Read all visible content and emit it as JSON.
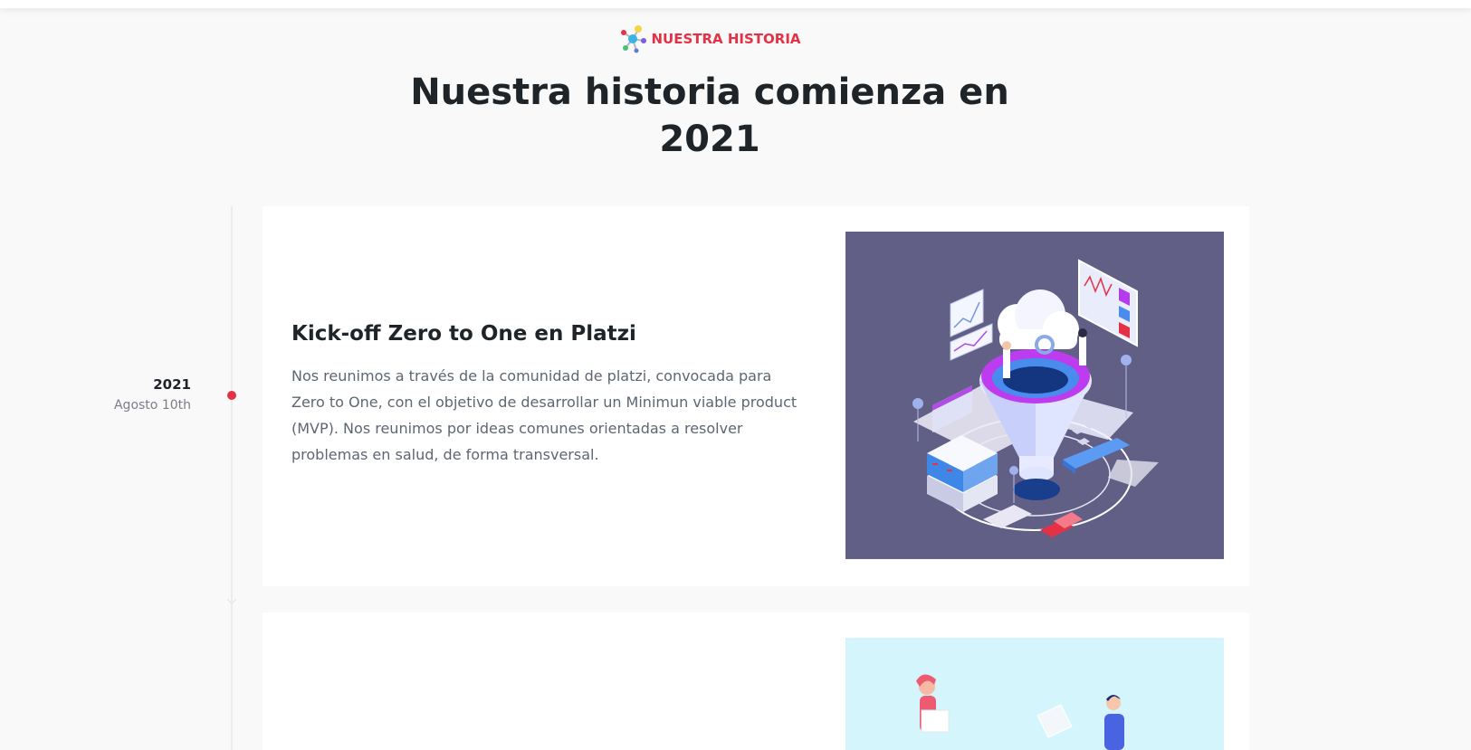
{
  "section": {
    "eyebrow": "NUESTRA HISTORIA",
    "title_line1": "Nuestra historia comienza en",
    "title_line2": "2021"
  },
  "timeline": [
    {
      "year": "2021",
      "date": "Agosto 10th",
      "title": "Kick-off Zero to One en Platzi",
      "text": "Nos reunimos a través de la comunidad de platzi, convocada para Zero to One, con el objetivo de desarrollar un Minimun viable product (MVP). Nos reunimos por ideas comunes orientadas a resolver problemas en salud, de forma transversal."
    }
  ],
  "colors": {
    "accent": "#e53145",
    "image1_bg": "#625f87",
    "image2_bg": "#d4f5fb"
  },
  "icons": {
    "logo": "molecule-logo-icon",
    "chevron": "chevron-down-icon"
  }
}
